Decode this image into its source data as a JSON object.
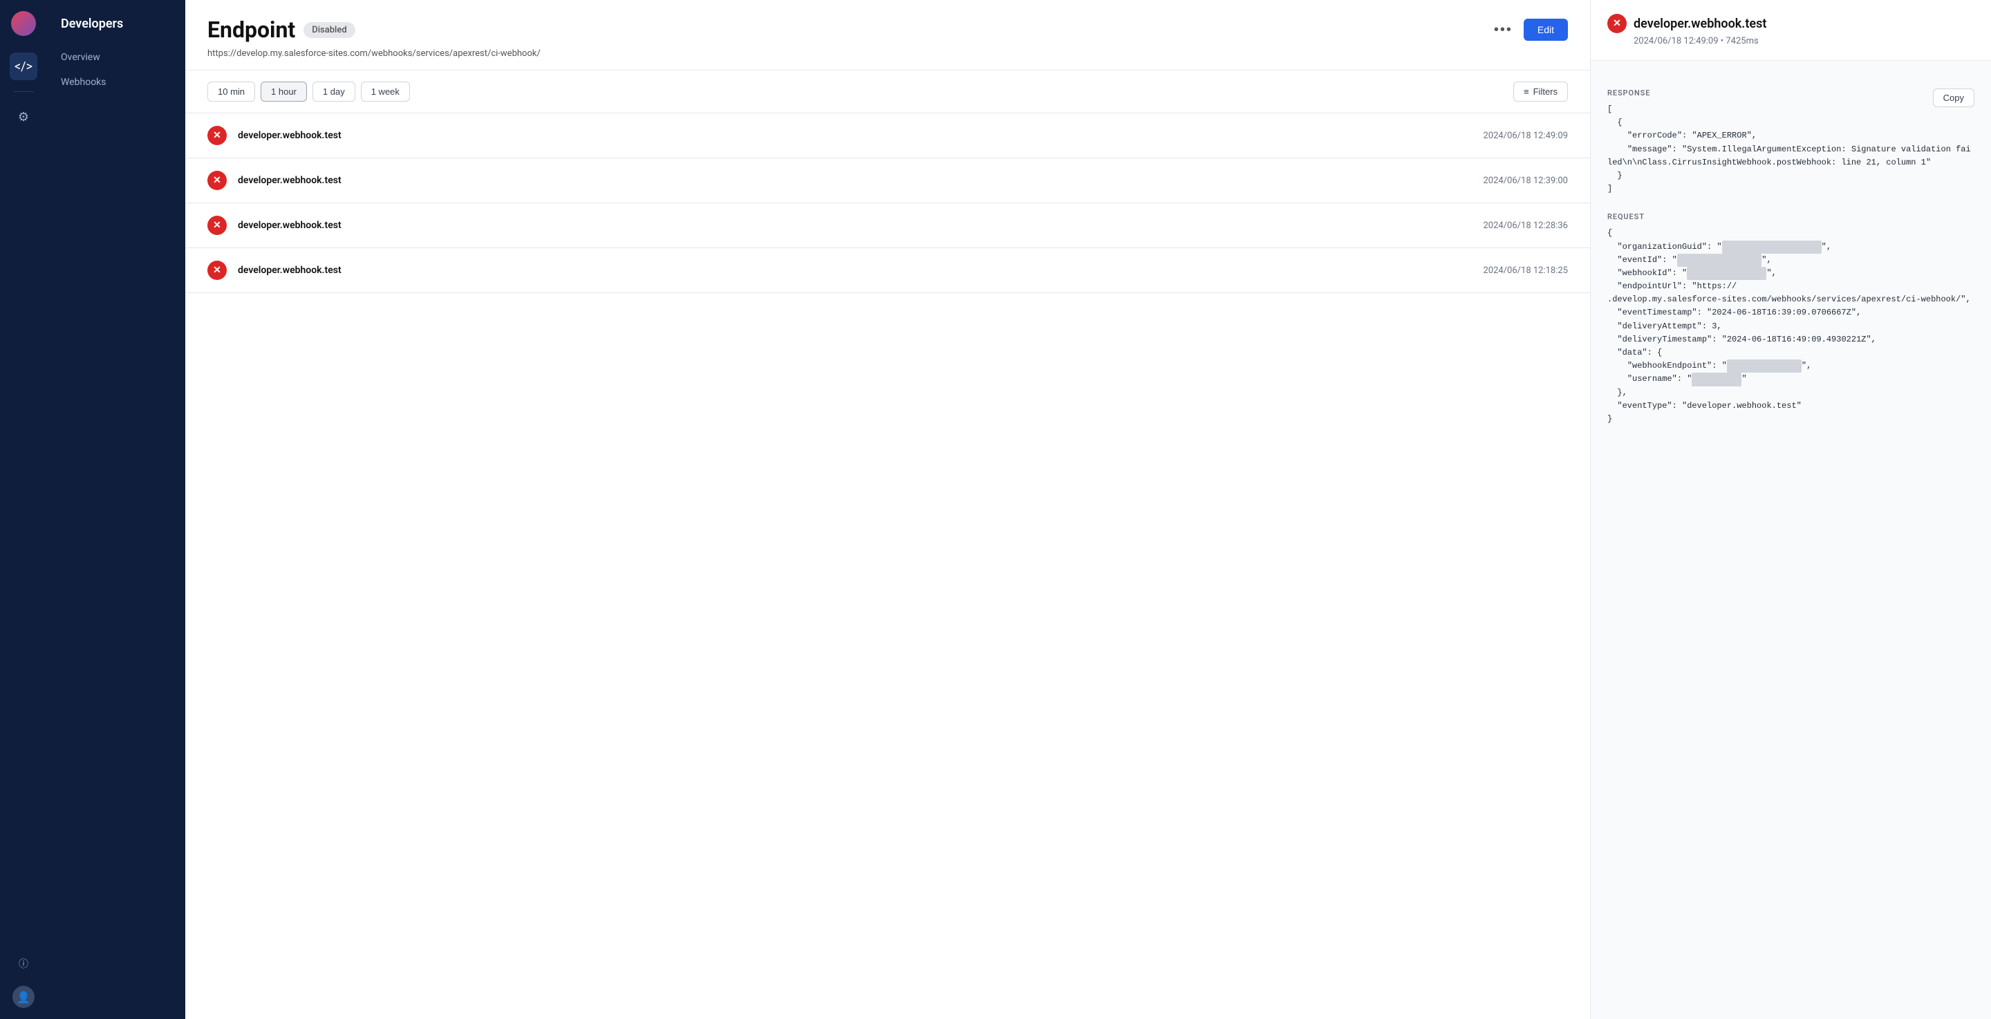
{
  "app": {
    "title": "Developers"
  },
  "sidebar": {
    "icons": [
      {
        "name": "code-icon",
        "symbol": "</>",
        "active": true
      },
      {
        "name": "settings-icon",
        "symbol": "⚙"
      }
    ],
    "bottom_icons": [
      {
        "name": "info-icon",
        "symbol": "ⓘ"
      },
      {
        "name": "user-icon",
        "symbol": "👤"
      }
    ]
  },
  "nav": {
    "title": "Developers",
    "items": [
      {
        "label": "Overview",
        "name": "overview"
      },
      {
        "label": "Webhooks",
        "name": "webhooks"
      }
    ]
  },
  "endpoint": {
    "title": "Endpoint",
    "status": "Disabled",
    "url": "https://develop.my.salesforce-sites.com/webhooks/services/apexrest/ci-webhook/",
    "edit_label": "Edit",
    "more_label": "•••"
  },
  "time_filters": {
    "options": [
      "10 min",
      "1 hour",
      "1 day",
      "1 week"
    ],
    "active": "1 hour",
    "filters_label": "Filters"
  },
  "webhook_rows": [
    {
      "name": "developer.webhook.test",
      "time": "2024/06/18 12:49:09",
      "status": "error"
    },
    {
      "name": "developer.webhook.test",
      "time": "2024/06/18 12:39:00",
      "status": "error"
    },
    {
      "name": "developer.webhook.test",
      "time": "2024/06/18 12:28:36",
      "status": "error"
    },
    {
      "name": "developer.webhook.test",
      "time": "2024/06/18 12:18:25",
      "status": "error"
    }
  ],
  "detail": {
    "title": "developer.webhook.test",
    "subtitle": "2024/06/18 12:49:09 • 7425ms",
    "copy_label": "Copy",
    "response_label": "RESPONSE",
    "response_code": "[\n  {\n    \"errorCode\": \"APEX_ERROR\",\n    \"message\": \"System.IllegalArgumentException: Signature validation failed\\n\\nClass.CirrusInsightWebhook.postWebhook: line 21, column 1\"\n  }\n]",
    "request_label": "REQUEST",
    "request_code": "{\n  \"organizationGuid\": \"                              \",\n  \"eventId\": \"                            \",\n  \"webhookId\": \"                           \",\n  \"endpointUrl\": \"https://\n.develop.my.salesforce-sites.com/webhooks/services/apexrest/ci-webhook/\",\n  \"eventTimestamp\": \"2024-06-18T16:39:09.0706667Z\",\n  \"deliveryAttempt\": 3,\n  \"deliveryTimestamp\": \"2024-06-18T16:49:09.4930221Z\",\n  \"data\": {\n    \"webhookEndpoint\": \"                              \",\n    \"username\": \"               \"\n  },\n  \"eventType\": \"developer.webhook.test\"\n}"
  }
}
